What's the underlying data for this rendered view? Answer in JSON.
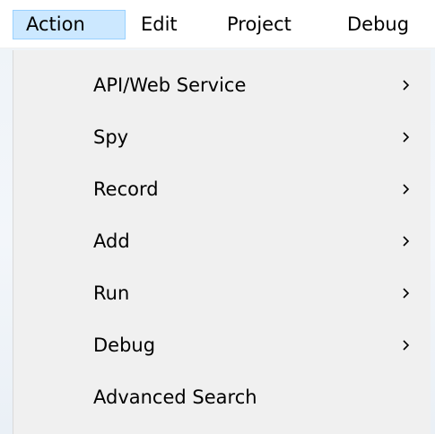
{
  "menubar": {
    "items": [
      {
        "label": "Action"
      },
      {
        "label": "Edit"
      },
      {
        "label": "Project"
      },
      {
        "label": "Debug"
      }
    ]
  },
  "action_menu": {
    "items": [
      {
        "label": "API/Web Service",
        "submenu": true
      },
      {
        "label": "Spy",
        "submenu": true
      },
      {
        "label": "Record",
        "submenu": true
      },
      {
        "label": "Add",
        "submenu": true
      },
      {
        "label": "Run",
        "submenu": true
      },
      {
        "label": "Debug",
        "submenu": true
      },
      {
        "label": "Advanced Search",
        "submenu": false
      }
    ]
  }
}
